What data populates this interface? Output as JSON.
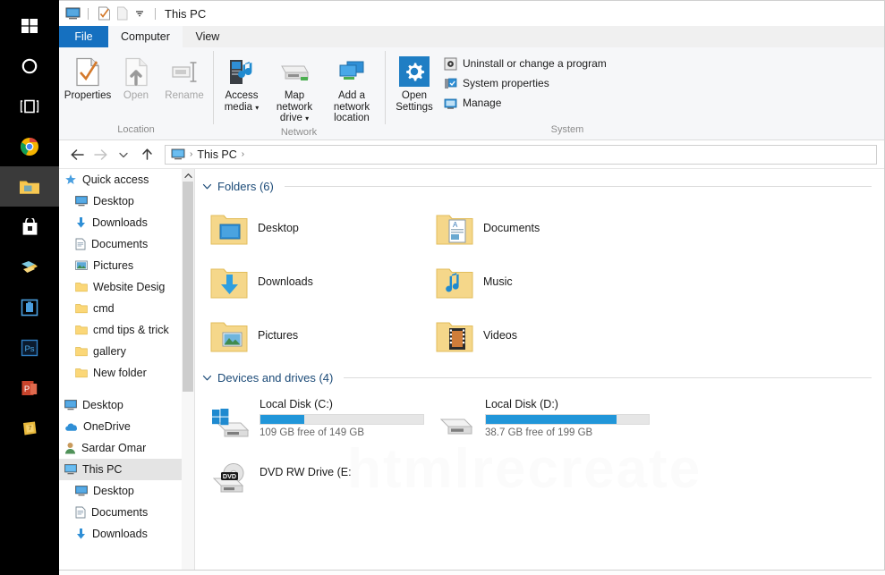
{
  "taskbar": {
    "items": [
      {
        "name": "start-button",
        "icon": "windows-logo-icon"
      },
      {
        "name": "cortana-button",
        "icon": "circle-icon"
      },
      {
        "name": "task-view-button",
        "icon": "task-view-icon"
      },
      {
        "name": "chrome-button",
        "icon": "chrome-icon"
      },
      {
        "name": "file-explorer-button",
        "icon": "folder-icon"
      },
      {
        "name": "microsoft-store-button",
        "icon": "store-bag-icon"
      },
      {
        "name": "sticky-notes-button",
        "icon": "notes-icon"
      },
      {
        "name": "app-button",
        "icon": "blue-app-icon"
      },
      {
        "name": "photoshop-button",
        "icon": "photoshop-icon"
      },
      {
        "name": "powerpoint-button",
        "icon": "powerpoint-icon"
      },
      {
        "name": "folder-app-button",
        "icon": "yellow-app-icon"
      }
    ]
  },
  "window": {
    "title": "This PC",
    "quick_access": [
      "computer-icon",
      "properties-icon",
      "new-folder-icon",
      "customize-chevron-icon"
    ]
  },
  "tabs": [
    {
      "label": "File",
      "state": "file"
    },
    {
      "label": "Computer",
      "state": "active"
    },
    {
      "label": "View",
      "state": "inactive"
    }
  ],
  "ribbon": {
    "groups": [
      {
        "label": "Location",
        "buttons": [
          {
            "label": "Properties",
            "icon": "properties-icon",
            "disabled": false
          },
          {
            "label": "Open",
            "icon": "open-icon",
            "disabled": true
          },
          {
            "label": "Rename",
            "icon": "rename-icon",
            "disabled": true
          }
        ]
      },
      {
        "label": "Network",
        "buttons": [
          {
            "label": "Access media",
            "icon": "access-media-icon",
            "dropdown": true
          },
          {
            "label": "Map network drive",
            "icon": "map-drive-icon",
            "dropdown": true
          },
          {
            "label": "Add a network location",
            "icon": "add-network-location-icon",
            "dropdown": false
          }
        ]
      },
      {
        "label": "System",
        "big": {
          "label": "Open Settings",
          "icon": "settings-gear-icon"
        },
        "small": [
          {
            "label": "Uninstall or change a program",
            "icon": "uninstall-icon"
          },
          {
            "label": "System properties",
            "icon": "system-properties-icon"
          },
          {
            "label": "Manage",
            "icon": "manage-icon"
          }
        ]
      }
    ]
  },
  "address_bar": {
    "back": "back-arrow-icon",
    "forward": "forward-arrow-icon",
    "recent": "chevron-down-icon",
    "up": "up-arrow-icon",
    "crumbs": [
      "This PC"
    ],
    "root_icon": "computer-icon"
  },
  "nav_pane": {
    "items": [
      {
        "label": "Quick access",
        "icon": "star-pin-icon",
        "indent": 0,
        "pinned": false,
        "selected": false
      },
      {
        "label": "Desktop",
        "icon": "desktop-icon",
        "indent": 1,
        "pinned": true,
        "selected": false
      },
      {
        "label": "Downloads",
        "icon": "downloads-icon",
        "indent": 1,
        "pinned": true,
        "selected": false
      },
      {
        "label": "Documents",
        "icon": "documents-icon",
        "indent": 1,
        "pinned": true,
        "selected": false
      },
      {
        "label": "Pictures",
        "icon": "pictures-icon",
        "indent": 1,
        "pinned": true,
        "selected": false
      },
      {
        "label": "Website Desig",
        "icon": "folder-icon",
        "indent": 1,
        "pinned": true,
        "selected": false
      },
      {
        "label": "cmd",
        "icon": "folder-icon",
        "indent": 1,
        "pinned": false,
        "selected": false
      },
      {
        "label": "cmd tips & trick",
        "icon": "folder-icon",
        "indent": 1,
        "pinned": false,
        "selected": false
      },
      {
        "label": "gallery",
        "icon": "folder-icon",
        "indent": 1,
        "pinned": false,
        "selected": false
      },
      {
        "label": "New folder",
        "icon": "folder-icon",
        "indent": 1,
        "pinned": false,
        "selected": false
      },
      {
        "label": "",
        "icon": "spacer",
        "indent": 0,
        "pinned": false,
        "selected": false
      },
      {
        "label": "Desktop",
        "icon": "desktop-icon",
        "indent": 0,
        "pinned": false,
        "selected": false
      },
      {
        "label": "OneDrive",
        "icon": "onedrive-icon",
        "indent": 0,
        "pinned": false,
        "selected": false
      },
      {
        "label": "Sardar Omar",
        "icon": "user-icon",
        "indent": 0,
        "pinned": false,
        "selected": false
      },
      {
        "label": "This PC",
        "icon": "computer-icon",
        "indent": 0,
        "pinned": false,
        "selected": true
      },
      {
        "label": "Desktop",
        "icon": "desktop-icon",
        "indent": 1,
        "pinned": false,
        "selected": false
      },
      {
        "label": "Documents",
        "icon": "documents-icon",
        "indent": 1,
        "pinned": false,
        "selected": false
      },
      {
        "label": "Downloads",
        "icon": "downloads-icon",
        "indent": 1,
        "pinned": false,
        "selected": false
      }
    ]
  },
  "content": {
    "folders_section": {
      "title": "Folders (6)",
      "chevron": "chevron-down-icon",
      "items": [
        {
          "name": "Desktop",
          "icon": "folder-desktop-icon"
        },
        {
          "name": "Documents",
          "icon": "folder-documents-icon"
        },
        {
          "name": "Downloads",
          "icon": "folder-downloads-icon"
        },
        {
          "name": "Music",
          "icon": "folder-music-icon"
        },
        {
          "name": "Pictures",
          "icon": "folder-pictures-icon"
        },
        {
          "name": "Videos",
          "icon": "folder-videos-icon"
        }
      ]
    },
    "drives_section": {
      "title": "Devices and drives (4)",
      "chevron": "chevron-down-icon",
      "items": [
        {
          "name": "Local Disk (C:)",
          "icon": "windows-drive-icon",
          "free_text": "109 GB free of 149 GB",
          "used_percent": 27,
          "bar_color": "#2196d9",
          "has_bar": true
        },
        {
          "name": "Local Disk (D:)",
          "icon": "hard-drive-icon",
          "free_text": "38.7 GB free of 199 GB",
          "used_percent": 80,
          "bar_color": "#2196d9",
          "has_bar": true
        },
        {
          "name": "DVD RW Drive (E:)",
          "icon": "dvd-drive-icon",
          "free_text": "",
          "used_percent": 0,
          "bar_color": "#2196d9",
          "has_bar": false
        }
      ]
    }
  },
  "colors": {
    "accent_blue": "#1570c0",
    "section_heading": "#1c4b78",
    "progress_blue": "#2196d9",
    "folder_yellow": "#fcd77f"
  }
}
